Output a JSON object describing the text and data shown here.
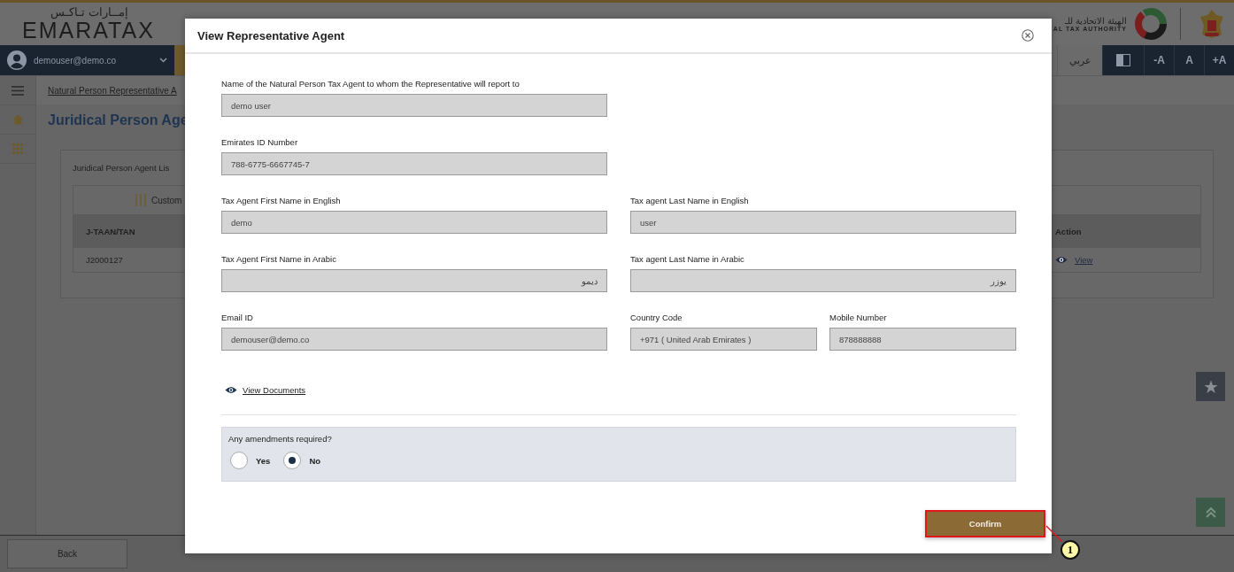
{
  "header": {
    "logo_arabic": "إمــارات تـاكـس",
    "logo_text": "EMARATAX",
    "authority_arabic": "الهيئة الاتحادية للـ",
    "authority_english": "AL TAX AUTHORITY"
  },
  "nav": {
    "user": "demouser@demo.co",
    "language": "عربي",
    "font_buttons": [
      "-A",
      "A",
      "+A"
    ]
  },
  "breadcrumb": "Natural Person Representative A",
  "page_title": "Juridical Person Age",
  "card": {
    "title": "Juridical Person Agent Lis",
    "toolbar_label": "Custom",
    "columns": [
      "J-TAAN/TAN",
      "Action"
    ],
    "rows": [
      {
        "j_taan_tan": "J2000127",
        "action": "View"
      }
    ]
  },
  "footer": {
    "back": "Back"
  },
  "modal": {
    "title": "View Representative Agent",
    "rows": [
      [
        {
          "label": "Name of the Natural Person Tax Agent to whom the Representative will report to",
          "value": "demo user"
        }
      ],
      [
        {
          "label": "Emirates ID Number",
          "value": "788-6775-6667745-7"
        }
      ],
      [
        {
          "label": "Tax Agent First Name in English",
          "value": "demo"
        },
        {
          "label": "Tax agent Last Name in English",
          "value": "user"
        }
      ],
      [
        {
          "label": "Tax Agent First Name in Arabic",
          "value": "ديمو",
          "rtl": true
        },
        {
          "label": "Tax agent Last Name in Arabic",
          "value": "يوزر",
          "rtl": true
        }
      ],
      [
        {
          "label": "Email ID",
          "value": "demouser@demo.co"
        },
        {
          "label": "Country Code",
          "value": "+971 ( United Arab Emirates )"
        },
        {
          "label": "Mobile Number",
          "value": "878888888"
        }
      ]
    ],
    "link": "View Documents",
    "question": {
      "label": "Any amendments required?",
      "options": [
        {
          "label": "Yes",
          "selected": false
        },
        {
          "label": "No",
          "selected": true
        }
      ]
    },
    "confirm": "Confirm"
  },
  "annotation": {
    "number": "1"
  }
}
